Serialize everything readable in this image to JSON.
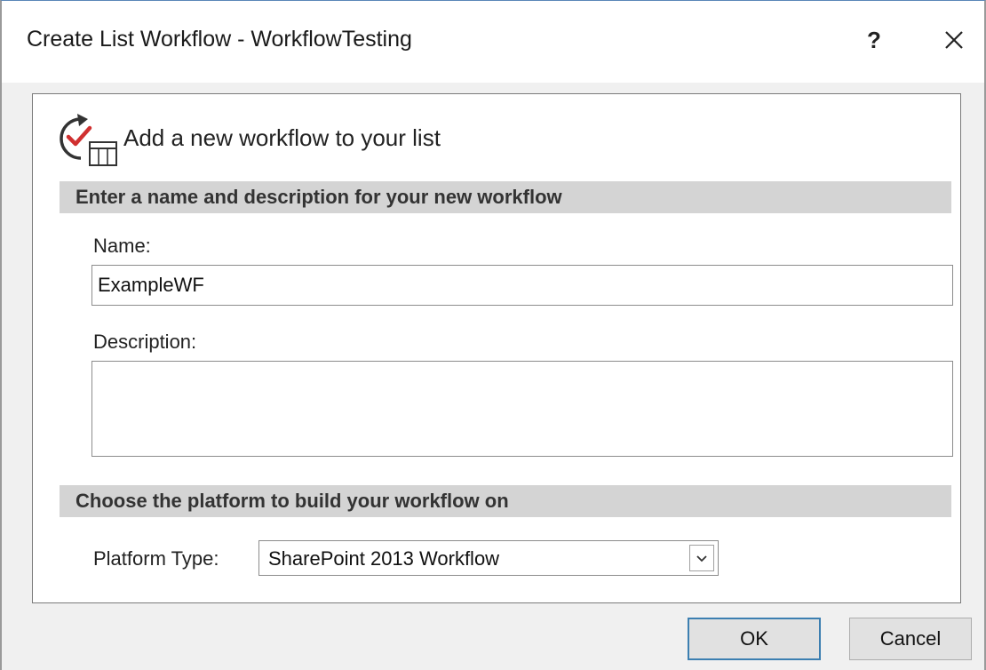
{
  "window": {
    "title": "Create List Workflow - WorkflowTesting",
    "help_label": "?"
  },
  "header": {
    "icon": "workflow-list-icon",
    "text": "Add a new workflow to your list"
  },
  "section_name": {
    "title": "Enter a name and description for your new workflow",
    "name_label": "Name:",
    "name_value": "ExampleWF",
    "description_label": "Description:",
    "description_value": ""
  },
  "section_platform": {
    "title": "Choose the platform to build your workflow on",
    "platform_label": "Platform Type:",
    "platform_value": "SharePoint 2013 Workflow"
  },
  "buttons": {
    "ok_label": "OK",
    "cancel_label": "Cancel"
  },
  "colors": {
    "accent": "#3c7fb1",
    "section_bar": "#d4d4d4",
    "dialog_bg": "#f0f0f0",
    "checkmark": "#d03030"
  }
}
